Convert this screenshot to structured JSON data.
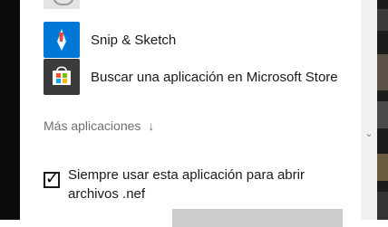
{
  "apps": [
    {
      "label": "Snip & Sketch",
      "icon": "snip-sketch-icon"
    },
    {
      "label": "Buscar una aplicación en Microsoft Store",
      "icon": "microsoft-store-icon"
    }
  ],
  "more_apps": {
    "label": "Más aplicaciones",
    "icon": "arrow-down-icon"
  },
  "always_use": {
    "label": "Siempre usar esta aplicación para abrir archivos .nef",
    "checked": true
  },
  "colors": {
    "accent": "#0078d7",
    "store_tile": "#3b3b3b"
  }
}
